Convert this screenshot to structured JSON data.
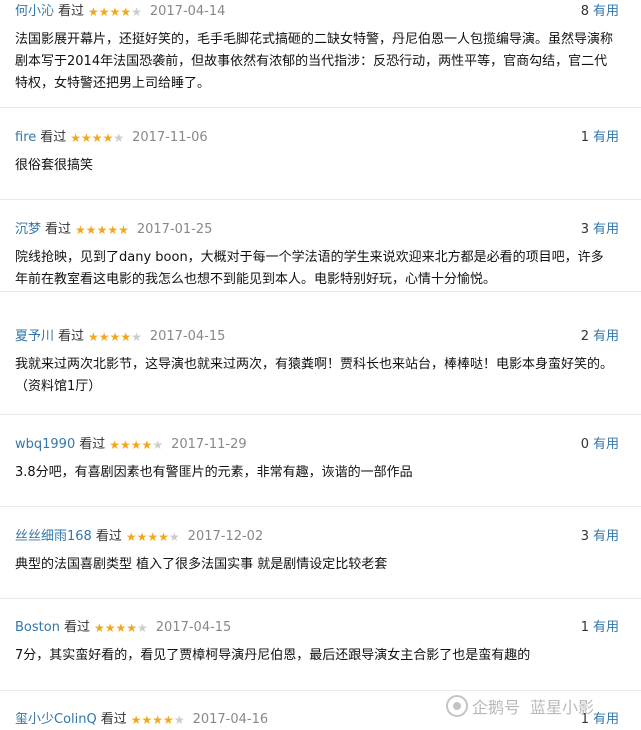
{
  "reviews": [
    {
      "user": "何小沁",
      "verb": "看过",
      "stars": 4,
      "date": "2017-04-14",
      "count": "8",
      "useful": "有用",
      "text": "法国影展开幕片，还挺好笑的，毛手毛脚花式搞砸的二缺女特警，丹尼伯恩一人包揽编导演。虽然导演称剧本写于2014年法国恐袭前，但故事依然有浓郁的当代指涉：反恐行动，两性平等，官商勾结，官二代特权，女特警还把男上司给睡了。"
    },
    {
      "user": "fire",
      "verb": "看过",
      "stars": 4,
      "date": "2017-11-06",
      "count": "1",
      "useful": "有用",
      "text": "很俗套很搞笑"
    },
    {
      "user": "沉梦",
      "verb": "看过",
      "stars": 5,
      "date": "2017-01-25",
      "count": "3",
      "useful": "有用",
      "text": "院线抢映，见到了dany boon，大概对于每一个学法语的学生来说欢迎来北方都是必看的项目吧，许多年前在教室看这电影的我怎么也想不到能见到本人。电影特别好玩，心情十分愉悦。"
    },
    {
      "user": "夏予川",
      "verb": "看过",
      "stars": 4,
      "date": "2017-04-15",
      "count": "2",
      "useful": "有用",
      "text": "我就来过两次北影节，这导演也就来过两次，有猿粪啊！贾科长也来站台，棒棒哒！电影本身蛮好笑的。（资料馆1厅）"
    },
    {
      "user": "wbq1990",
      "verb": "看过",
      "stars": 4,
      "date": "2017-11-29",
      "count": "0",
      "useful": "有用",
      "text": "3.8分吧，有喜剧因素也有警匪片的元素，非常有趣，诙谐的一部作品"
    },
    {
      "user": "丝丝细雨168",
      "verb": "看过",
      "stars": 4,
      "date": "2017-12-02",
      "count": "3",
      "useful": "有用",
      "text": "典型的法国喜剧类型 植入了很多法国实事 就是剧情设定比较老套"
    },
    {
      "user": "Boston",
      "verb": "看过",
      "stars": 4,
      "date": "2017-04-15",
      "count": "1",
      "useful": "有用",
      "text": "7分，其实蛮好看的，看见了贾樟柯导演丹尼伯恩，最后还跟导演女主合影了也是蛮有趣的"
    },
    {
      "user": "玺小少ColinQ",
      "verb": "看过",
      "stars": 4,
      "date": "2017-04-16",
      "count": "1",
      "useful": "有用",
      "text": ""
    }
  ],
  "watermark": {
    "brand": "企鹅号",
    "account": "蓝星小影"
  }
}
